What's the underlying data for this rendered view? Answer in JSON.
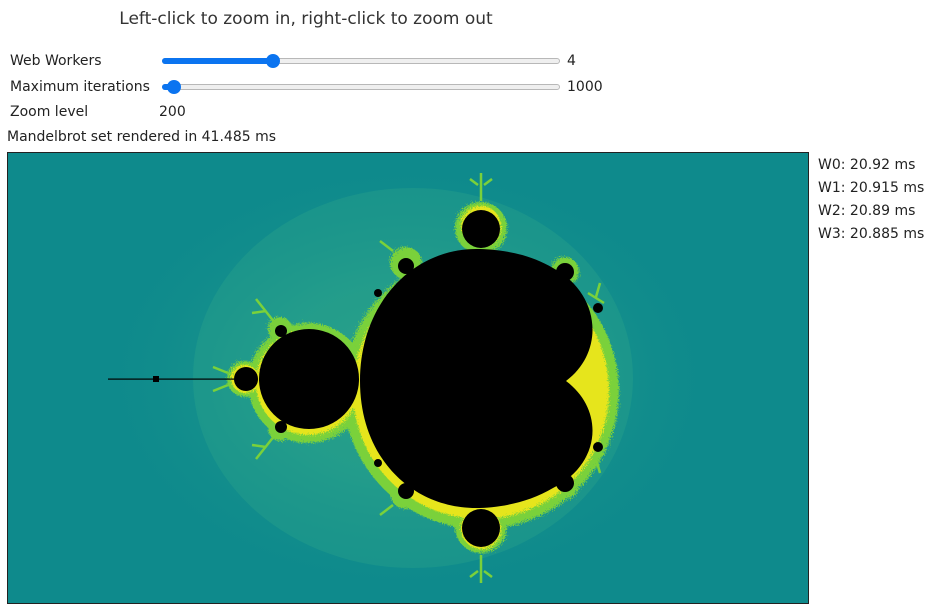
{
  "header": {
    "instructions": "Left-click to zoom in, right-click to zoom out"
  },
  "controls": {
    "web_workers": {
      "label": "Web Workers",
      "value": "4",
      "fraction": 0.28
    },
    "max_iterations": {
      "label": "Maximum iterations",
      "value": "1000",
      "fraction": 0.03
    },
    "zoom": {
      "label": "Zoom level",
      "value": "200"
    }
  },
  "status": {
    "render_time": "Mandelbrot set rendered in 41.485 ms"
  },
  "workers": [
    {
      "label": "W0: 20.92 ms"
    },
    {
      "label": "W1: 20.915 ms"
    },
    {
      "label": "W2: 20.89 ms"
    },
    {
      "label": "W3: 20.885 ms"
    }
  ],
  "colors": {
    "accent": "#0b74f0",
    "fractal_background": "#0e8a8c",
    "fractal_inner_glow": "#2aa28c",
    "fractal_edge_green": "#7ad13a",
    "fractal_edge_yellow": "#e6e51b",
    "fractal_set": "#000000"
  }
}
